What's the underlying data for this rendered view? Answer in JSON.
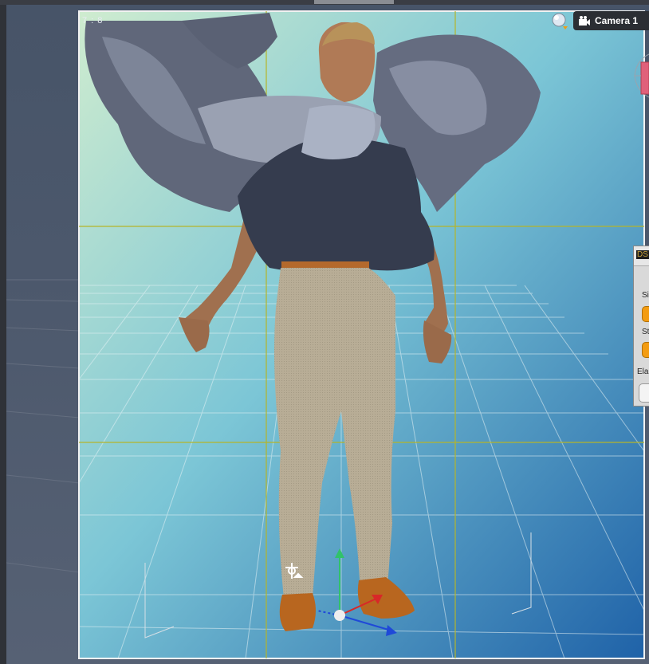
{
  "viewport": {
    "aspect_label": "7 : 8",
    "camera_label": "Camera 1"
  },
  "dock_panel": {
    "badge": "DS",
    "label_1": "Si",
    "label_2": "St",
    "label_3": "Ela"
  },
  "icons": {
    "camera": "camera-icon",
    "sphere": "render-sphere-icon",
    "light": "light-gizmo-icon",
    "gizmo": "transform-gizmo-icon",
    "nav": "navigation-cube-icon"
  },
  "colors": {
    "guide": "#b5b52a",
    "accent": "#f39c12"
  }
}
